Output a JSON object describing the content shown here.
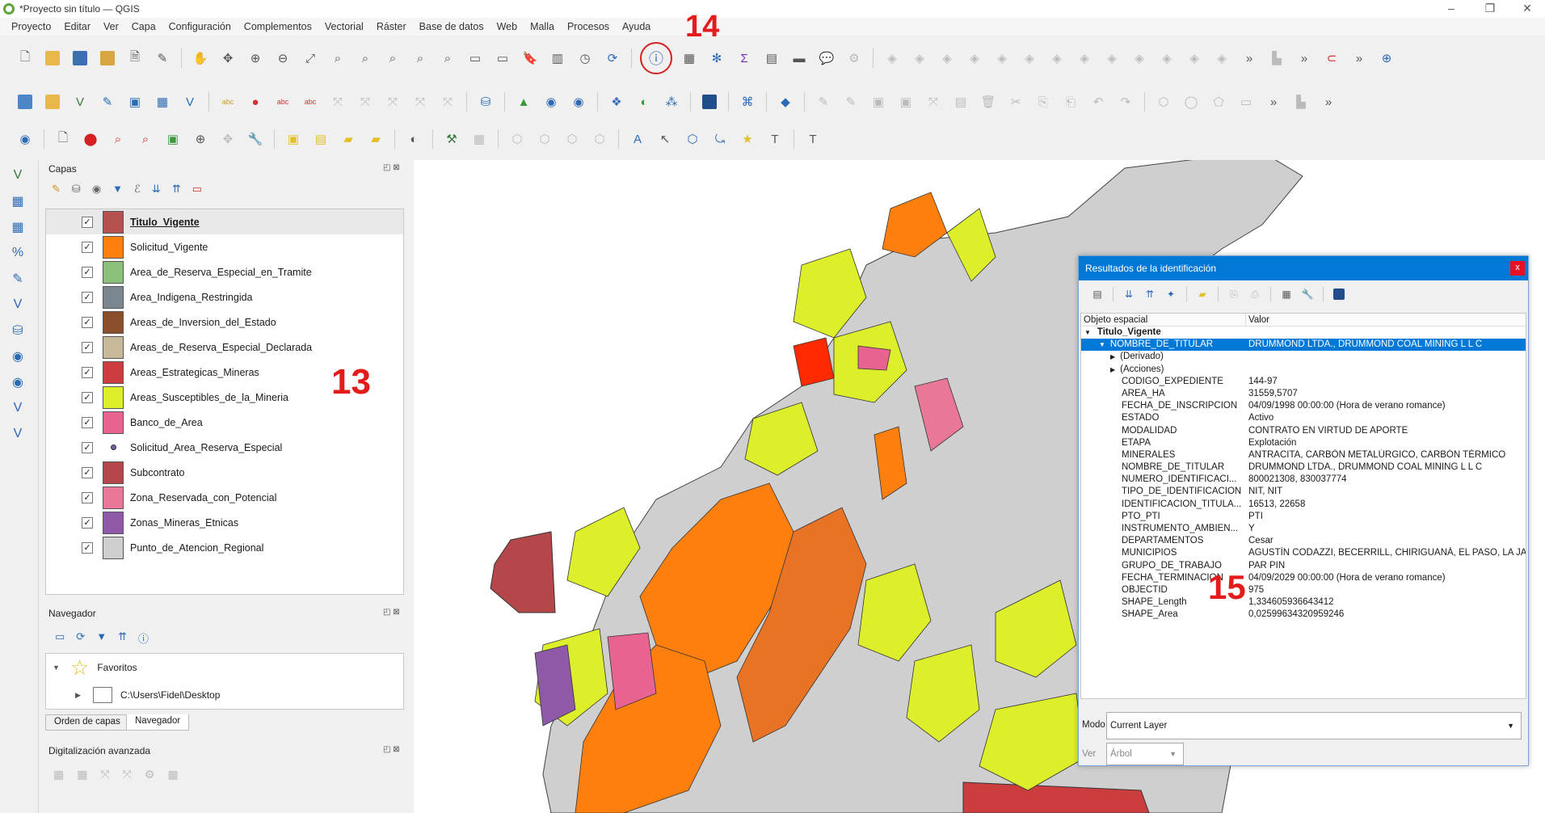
{
  "window": {
    "title": "*Proyecto sin título — QGIS"
  },
  "menu": [
    "Proyecto",
    "Editar",
    "Ver",
    "Capa",
    "Configuración",
    "Complementos",
    "Vectorial",
    "Ráster",
    "Base de datos",
    "Web",
    "Malla",
    "Procesos",
    "Ayuda"
  ],
  "annotations": {
    "a14": "14",
    "a13": "13",
    "a15": "15"
  },
  "layers_panel": {
    "title": "Capas",
    "items": [
      {
        "name": "Titulo_Vigente",
        "color": "#b5514f",
        "selected": true
      },
      {
        "name": "Solicitud_Vigente",
        "color": "#ff7f0e"
      },
      {
        "name": "Area_de_Reserva_Especial_en_Tramite",
        "color": "#8cbf7a"
      },
      {
        "name": "Area_Indigena_Restringida",
        "color": "#7b8790"
      },
      {
        "name": "Areas_de_Inversion_del_Estado",
        "color": "#8b4f2c"
      },
      {
        "name": "Areas_de_Reserva_Especial_Declarada",
        "color": "#c7b89a"
      },
      {
        "name": "Areas_Estrategicas_Mineras",
        "color": "#cc3e3e"
      },
      {
        "name": "Areas_Susceptibles_de_la_Mineria",
        "color": "#dcef2a"
      },
      {
        "name": "Banco_de_Area",
        "color": "#e8638f"
      },
      {
        "name": "Solicitud_Area_Reserva_Especial",
        "point": true
      },
      {
        "name": "Subcontrato",
        "color": "#b5474a"
      },
      {
        "name": "Zona_Reservada_con_Potencial",
        "color": "#e97898"
      },
      {
        "name": "Zonas_Mineras_Etnicas",
        "color": "#8e5aa8"
      },
      {
        "name": "Punto_de_Atencion_Regional",
        "color": "#cfcfcf"
      }
    ]
  },
  "navigator_panel": {
    "title": "Navegador",
    "items": [
      {
        "label": "Favoritos"
      },
      {
        "label": "C:\\Users\\Fidel\\Desktop"
      }
    ],
    "tabs": [
      "Orden de capas",
      "Navegador"
    ]
  },
  "digitizing_panel": {
    "title": "Digitalización avanzada"
  },
  "identify": {
    "title": "Resultados de la identificación",
    "col_feature": "Objeto espacial",
    "col_value": "Valor",
    "layer": "Titulo_Vigente",
    "rows": [
      {
        "k": "NOMBRE_DE_TITULAR",
        "v": "DRUMMOND LTDA., DRUMMOND COAL MINING L L C",
        "sel": true
      },
      {
        "k": "(Derivado)",
        "v": "",
        "expand": true
      },
      {
        "k": "(Acciones)",
        "v": "",
        "expand": true
      },
      {
        "k": "CODIGO_EXPEDIENTE",
        "v": "144-97"
      },
      {
        "k": "AREA_HA",
        "v": "31559,5707"
      },
      {
        "k": "FECHA_DE_INSCRIPCION",
        "v": "04/09/1998 00:00:00 (Hora de verano romance)"
      },
      {
        "k": "ESTADO",
        "v": "Activo"
      },
      {
        "k": "MODALIDAD",
        "v": "CONTRATO EN VIRTUD DE APORTE"
      },
      {
        "k": "ETAPA",
        "v": "Explotación"
      },
      {
        "k": "MINERALES",
        "v": "ANTRACITA, CARBÓN METALÚRGICO, CARBÓN TÉRMICO"
      },
      {
        "k": "NOMBRE_DE_TITULAR",
        "v": "DRUMMOND LTDA., DRUMMOND COAL MINING L L C"
      },
      {
        "k": "NUMERO_IDENTIFICACI...",
        "v": "800021308, 830037774"
      },
      {
        "k": "TIPO_DE_IDENTIFICACION",
        "v": "NIT, NIT"
      },
      {
        "k": "IDENTIFICACION_TITULA...",
        "v": "16513, 22658"
      },
      {
        "k": "PTO_PTI",
        "v": "PTI"
      },
      {
        "k": "INSTRUMENTO_AMBIEN...",
        "v": "Y"
      },
      {
        "k": "DEPARTAMENTOS",
        "v": "Cesar"
      },
      {
        "k": "MUNICIPIOS",
        "v": "AGUSTÍN CODAZZI, BECERRILL, CHIRIGUANÁ, EL PASO, LA JA..."
      },
      {
        "k": "GRUPO_DE_TRABAJO",
        "v": "PAR PIN"
      },
      {
        "k": "FECHA_TERMINACION",
        "v": "04/09/2029 00:00:00 (Hora de verano romance)"
      },
      {
        "k": "OBJECTID",
        "v": "975"
      },
      {
        "k": "SHAPE_Length",
        "v": "1,334605936643412"
      },
      {
        "k": "SHAPE_Area",
        "v": "0,02599634320959246"
      }
    ],
    "mode_label": "Modo",
    "mode_value": "Current Layer",
    "view_label": "Ver",
    "view_value": "Árbol"
  }
}
